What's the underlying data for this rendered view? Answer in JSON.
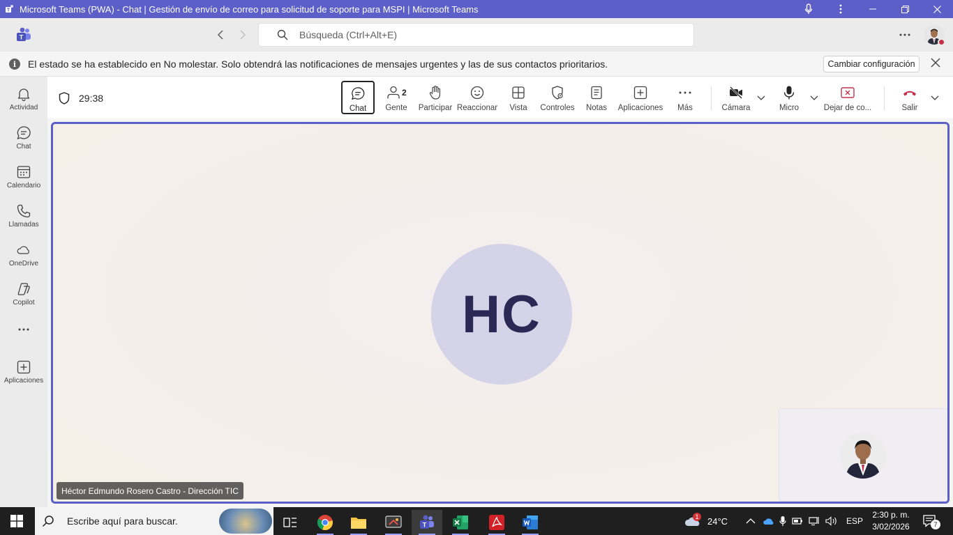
{
  "window": {
    "title": "Microsoft Teams (PWA) - Chat | Gestión de envío de correo para solicitud de soporte para MSPI | Microsoft Teams"
  },
  "topbar": {
    "search_placeholder": "Búsqueda (Ctrl+Alt+E)"
  },
  "notification": {
    "message": "El estado se ha establecido en No molestar. Solo obtendrá las notificaciones de mensajes urgentes y las de sus contactos prioritarios.",
    "button_label": "Cambiar configuración"
  },
  "rail": {
    "items": [
      {
        "label": "Actividad",
        "icon": "bell-icon"
      },
      {
        "label": "Chat",
        "icon": "chat-icon"
      },
      {
        "label": "Calendario",
        "icon": "calendar-icon"
      },
      {
        "label": "Llamadas",
        "icon": "phone-icon"
      },
      {
        "label": "OneDrive",
        "icon": "cloud-icon"
      },
      {
        "label": "Copilot",
        "icon": "copilot-icon"
      },
      {
        "label": "Aplicaciones",
        "icon": "add-apps-icon"
      }
    ]
  },
  "call": {
    "timer": "29:38",
    "controls": {
      "chat": "Chat",
      "people": "Gente",
      "people_count": "2",
      "raise": "Participar",
      "react": "Reaccionar",
      "view": "Vista",
      "controls": "Controles",
      "notes": "Notas",
      "apps": "Aplicaciones",
      "more": "Más",
      "camera": "Cámara",
      "mic": "Micro",
      "stop_share": "Dejar de co...",
      "leave": "Salir"
    }
  },
  "stage": {
    "participant_initials": "HC",
    "participant_name": "Héctor Edmundo Rosero Castro - Dirección TIC"
  },
  "taskbar": {
    "search_text": "Escribe aquí para buscar.",
    "weather_temp": "24°C",
    "weather_badge": "1",
    "language": "ESP",
    "time": "2:30 p. m.",
    "date": "3/02/2026",
    "notifications_count": "7"
  },
  "colors": {
    "accent": "#5b5fc7",
    "leave_red": "#c4314b",
    "stop_share_red": "#c4314b"
  }
}
